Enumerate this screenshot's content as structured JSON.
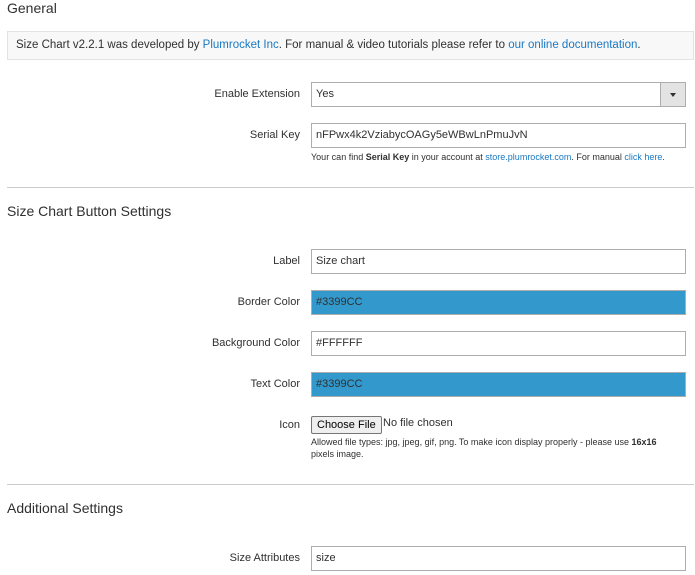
{
  "general": {
    "title": "General",
    "notice_prefix": "Size Chart v2.2.1 was developed by ",
    "notice_company": "Plumrocket Inc",
    "notice_mid": ". For manual & video tutorials please refer to ",
    "notice_link": "our online documentation",
    "notice_suffix": ".",
    "enable_label": "Enable Extension",
    "enable_value": "Yes",
    "serial_label": "Serial Key",
    "serial_value": "nFPwx4k2VziabycOAGy5eWBwLnPmuJvN",
    "serial_note_1": "Your can find ",
    "serial_note_bold": "Serial Key",
    "serial_note_2": " in your account at ",
    "serial_note_link1": "store.plumrocket.com",
    "serial_note_3": ". For manual ",
    "serial_note_link2": "click here",
    "serial_note_4": "."
  },
  "button_settings": {
    "title": "Size Chart Button Settings",
    "label_label": "Label",
    "label_value": "Size chart",
    "border_label": "Border Color",
    "border_value": "#3399CC",
    "bg_label": "Background Color",
    "bg_value": "#FFFFFF",
    "text_label": "Text Color",
    "text_value": "#3399CC",
    "icon_label": "Icon",
    "choose_file": "Choose File",
    "no_file": "No file chosen",
    "icon_note_1": "Allowed file types: jpg, jpeg, gif, png. To make icon display properly - please use ",
    "icon_note_bold": "16x16",
    "icon_note_2": "pixels image."
  },
  "additional": {
    "title": "Additional Settings",
    "attr_label": "Size Attributes",
    "attr_value": "size"
  },
  "colors": {
    "swatch": "#3399CC",
    "link": "#1979c3"
  }
}
